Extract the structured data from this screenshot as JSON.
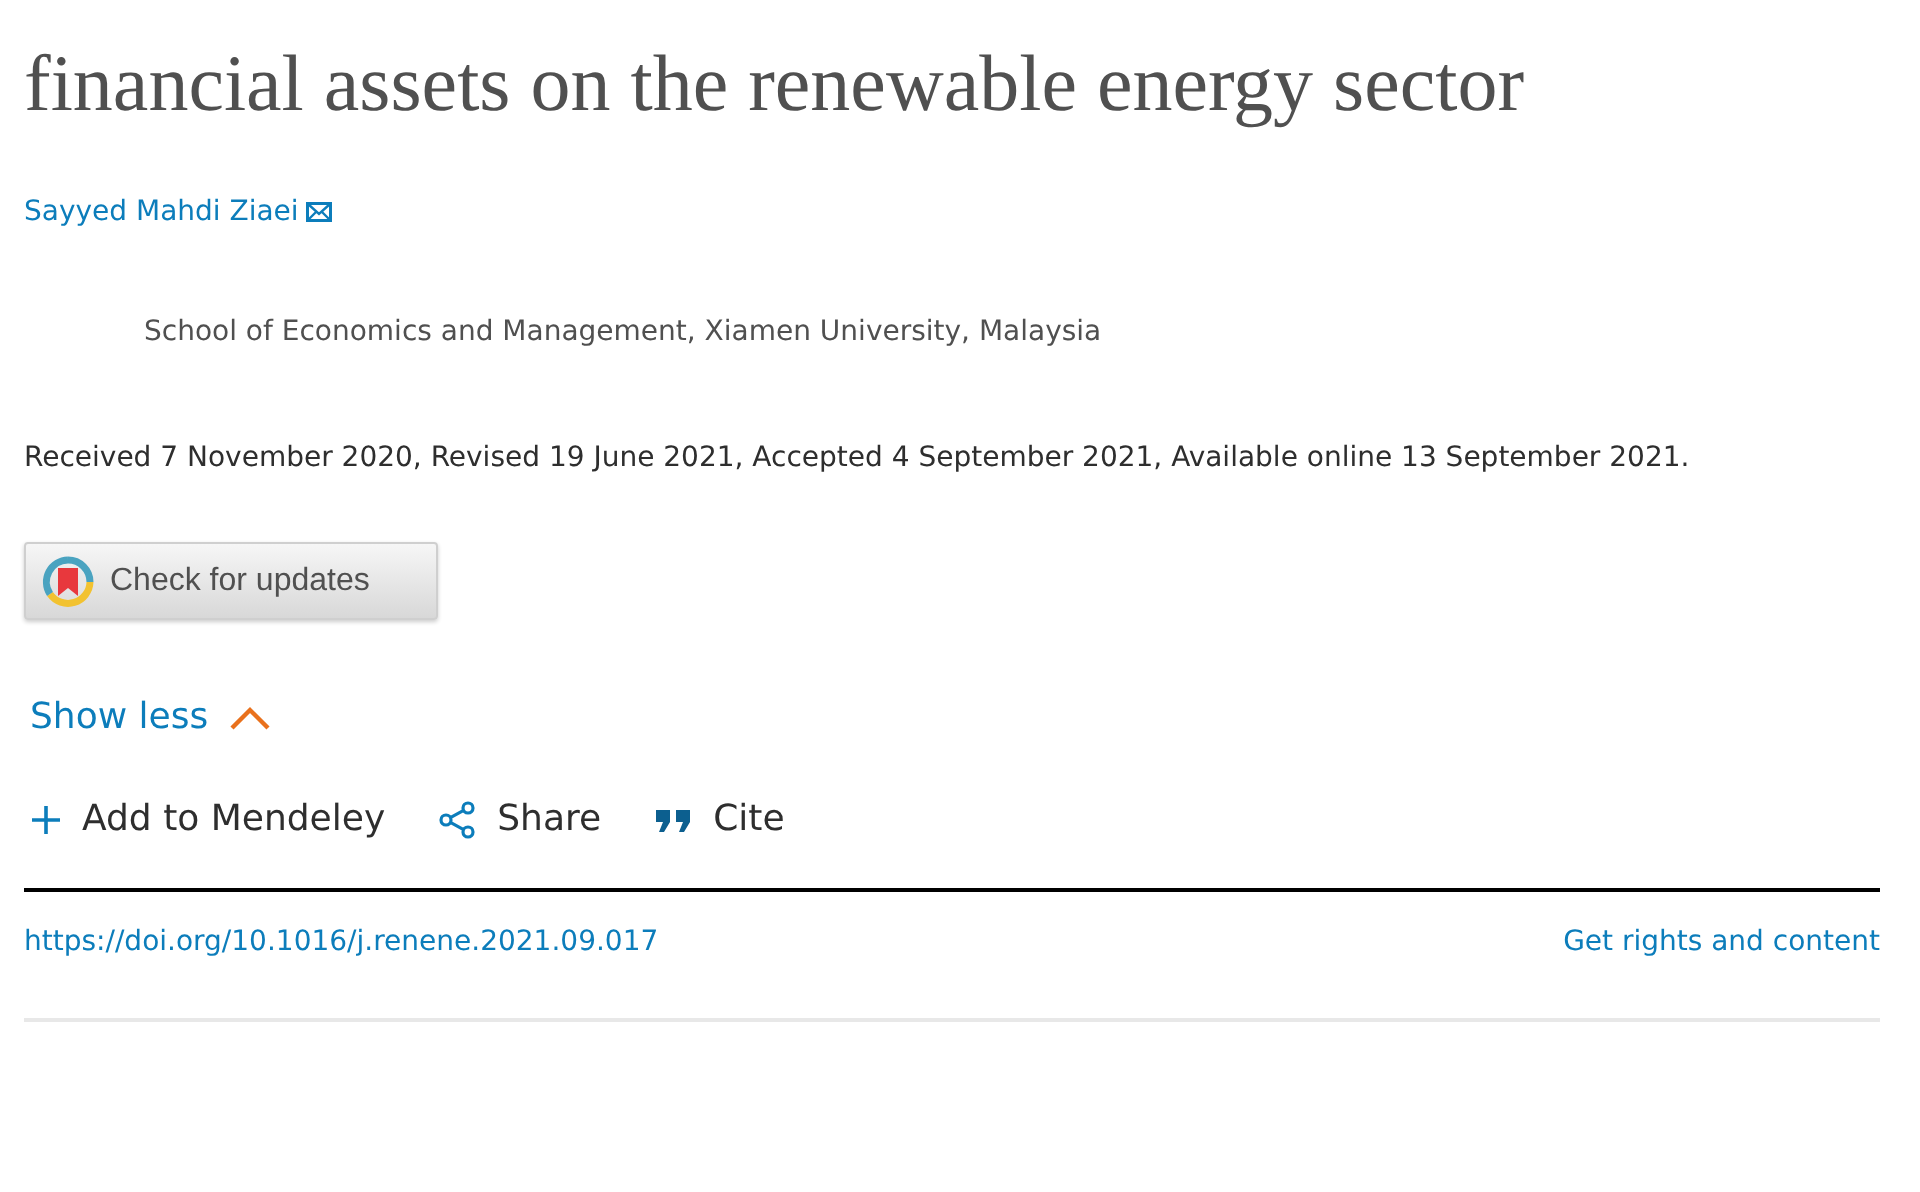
{
  "title": "financial assets on the renewable energy sector",
  "author": {
    "name": "Sayyed Mahdi Ziaei"
  },
  "affiliation": "School of Economics and Management, Xiamen University, Malaysia",
  "history": "Received 7 November 2020, Revised 19 June 2021, Accepted 4 September 2021, Available online 13 September 2021.",
  "check_button": "Check for updates",
  "toggle": {
    "label": "Show less",
    "expanded": true
  },
  "actions": [
    {
      "kind": "add",
      "label": "Add to Mendeley"
    },
    {
      "kind": "share",
      "label": "Share"
    },
    {
      "kind": "cite",
      "label": "Cite"
    }
  ],
  "doi": "https://doi.org/10.1016/j.renene.2021.09.017",
  "rights": "Get rights and content"
}
